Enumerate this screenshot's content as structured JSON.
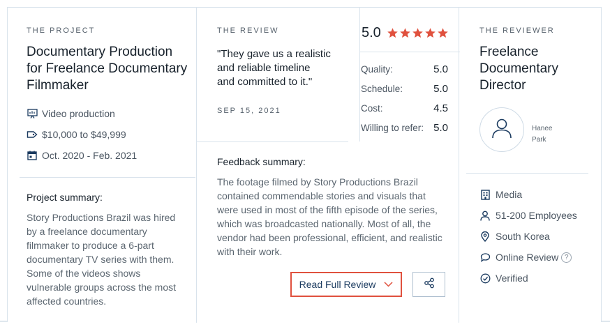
{
  "project": {
    "eyebrow": "THE PROJECT",
    "title": "Documentary Production for Freelance Documentary Filmmaker",
    "service": "Video production",
    "budget": "$10,000 to $49,999",
    "dates": "Oct. 2020 - Feb. 2021",
    "summary_heading": "Project summary:",
    "summary_lines": [
      "Story Productions Brazil was hired",
      "by a freelance documentary",
      "filmmaker to produce a 6-part",
      "documentary TV series with them.",
      "Some of the videos shows",
      "vulnerable groups across the most",
      "affected countries."
    ]
  },
  "review": {
    "eyebrow": "THE REVIEW",
    "quote_lines": [
      "\"They gave us a realistic",
      "and reliable timeline",
      "and committed to it.\""
    ],
    "date": "SEP 15, 2021",
    "overall": "5.0",
    "star_count": 5,
    "star_color": "#e0513e",
    "scores": [
      {
        "label": "Quality:",
        "value": "5.0"
      },
      {
        "label": "Schedule:",
        "value": "5.0"
      },
      {
        "label": "Cost:",
        "value": "4.5"
      },
      {
        "label": "Willing to refer:",
        "value": "5.0"
      }
    ],
    "feedback_heading": "Feedback summary:",
    "feedback_lines": [
      "The footage filmed by Story Productions Brazil",
      "contained commendable stories and visuals that",
      "were used in most of the fifth episode of the series,",
      "which was broadcasted nationally. Most of all, the",
      "vendor had been professional, efficient, and realistic",
      "with their work."
    ],
    "read_button": "Read Full Review",
    "accent_color": "#e0513e"
  },
  "reviewer": {
    "eyebrow": "THE REVIEWER",
    "title": "Freelance Documentary Director",
    "name_lines": [
      "Hanee",
      "Park"
    ],
    "industry": "Media",
    "size": "51-200 Employees",
    "location": "South Korea",
    "review_type": "Online Review",
    "status": "Verified",
    "help_glyph": "?"
  }
}
